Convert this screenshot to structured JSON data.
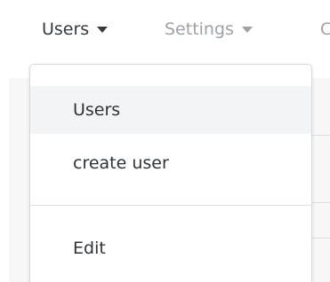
{
  "nav": {
    "items": [
      {
        "label": "Users",
        "state": "active"
      },
      {
        "label": "Settings",
        "state": "inactive"
      },
      {
        "label": "C",
        "state": "inactive"
      }
    ]
  },
  "dropdown": {
    "items": [
      {
        "label": "Users",
        "highlighted": true
      },
      {
        "label": "create user",
        "highlighted": false
      },
      {
        "label": "Edit",
        "highlighted": false
      }
    ]
  },
  "colors": {
    "active_text": "#333a40",
    "inactive_text": "#9da2a7",
    "menu_text": "#2f3337",
    "highlight_bg": "#f3f4f5",
    "border": "#d9dadd"
  },
  "icons": {
    "caret": "chevron-down-icon"
  }
}
